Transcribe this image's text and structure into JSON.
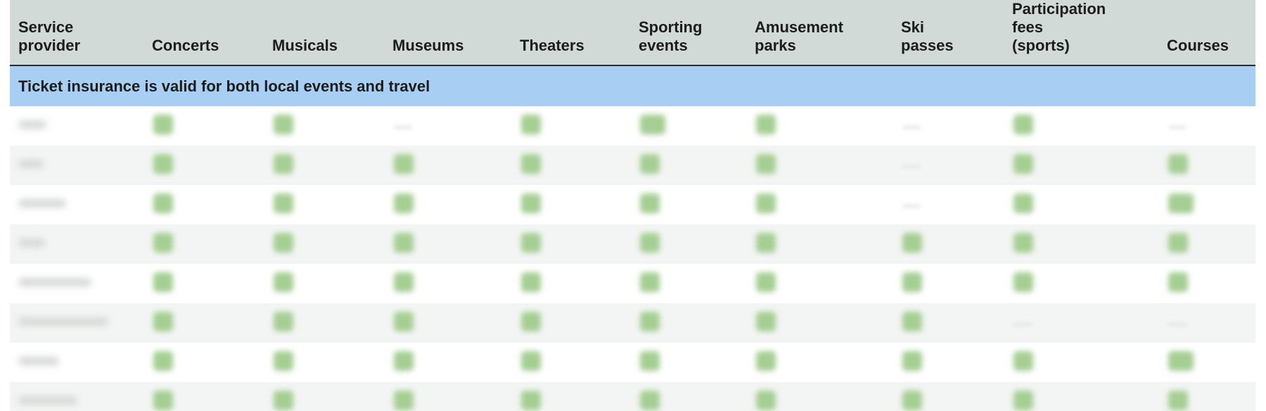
{
  "table": {
    "columns": [
      {
        "lines": [
          "Service",
          "provider"
        ]
      },
      {
        "lines": [
          "Concerts"
        ]
      },
      {
        "lines": [
          "Musicals"
        ]
      },
      {
        "lines": [
          "Museums"
        ]
      },
      {
        "lines": [
          "Theaters"
        ]
      },
      {
        "lines": [
          "Sporting",
          "events"
        ]
      },
      {
        "lines": [
          "Amusement",
          "parks"
        ]
      },
      {
        "lines": [
          "Ski",
          "passes"
        ]
      },
      {
        "lines": [
          "Participation",
          "fees",
          "(sports)"
        ]
      },
      {
        "lines": [
          "Courses"
        ]
      }
    ],
    "section_title": "Ticket insurance is valid for both local events and travel",
    "rows": [
      [
        "check",
        "check",
        "none",
        "check",
        "check-note",
        "check",
        "none",
        "check",
        "none"
      ],
      [
        "check",
        "check",
        "check",
        "check",
        "check",
        "check",
        "none",
        "check",
        "check"
      ],
      [
        "check",
        "check",
        "check",
        "check",
        "check",
        "check",
        "none",
        "check",
        "check-note"
      ],
      [
        "check",
        "check",
        "check",
        "check",
        "check",
        "check",
        "check",
        "check",
        "check"
      ],
      [
        "check",
        "check",
        "check",
        "check",
        "check",
        "check",
        "check",
        "check",
        "check"
      ],
      [
        "check",
        "check",
        "check",
        "check",
        "check",
        "check",
        "check",
        "none",
        "none"
      ],
      [
        "check",
        "check",
        "check",
        "check",
        "check",
        "check",
        "check",
        "check",
        "check-note"
      ],
      [
        "check",
        "check",
        "check",
        "check",
        "check",
        "check",
        "check",
        "check",
        "check"
      ]
    ],
    "row_name_widths": [
      40,
      36,
      68,
      38,
      104,
      128,
      58,
      84
    ],
    "colors": {
      "header_bg": "#d2dad7",
      "section_bg": "#a8cff3",
      "check": "#a5ce93",
      "row_stripe": "#f3f5f4"
    }
  }
}
